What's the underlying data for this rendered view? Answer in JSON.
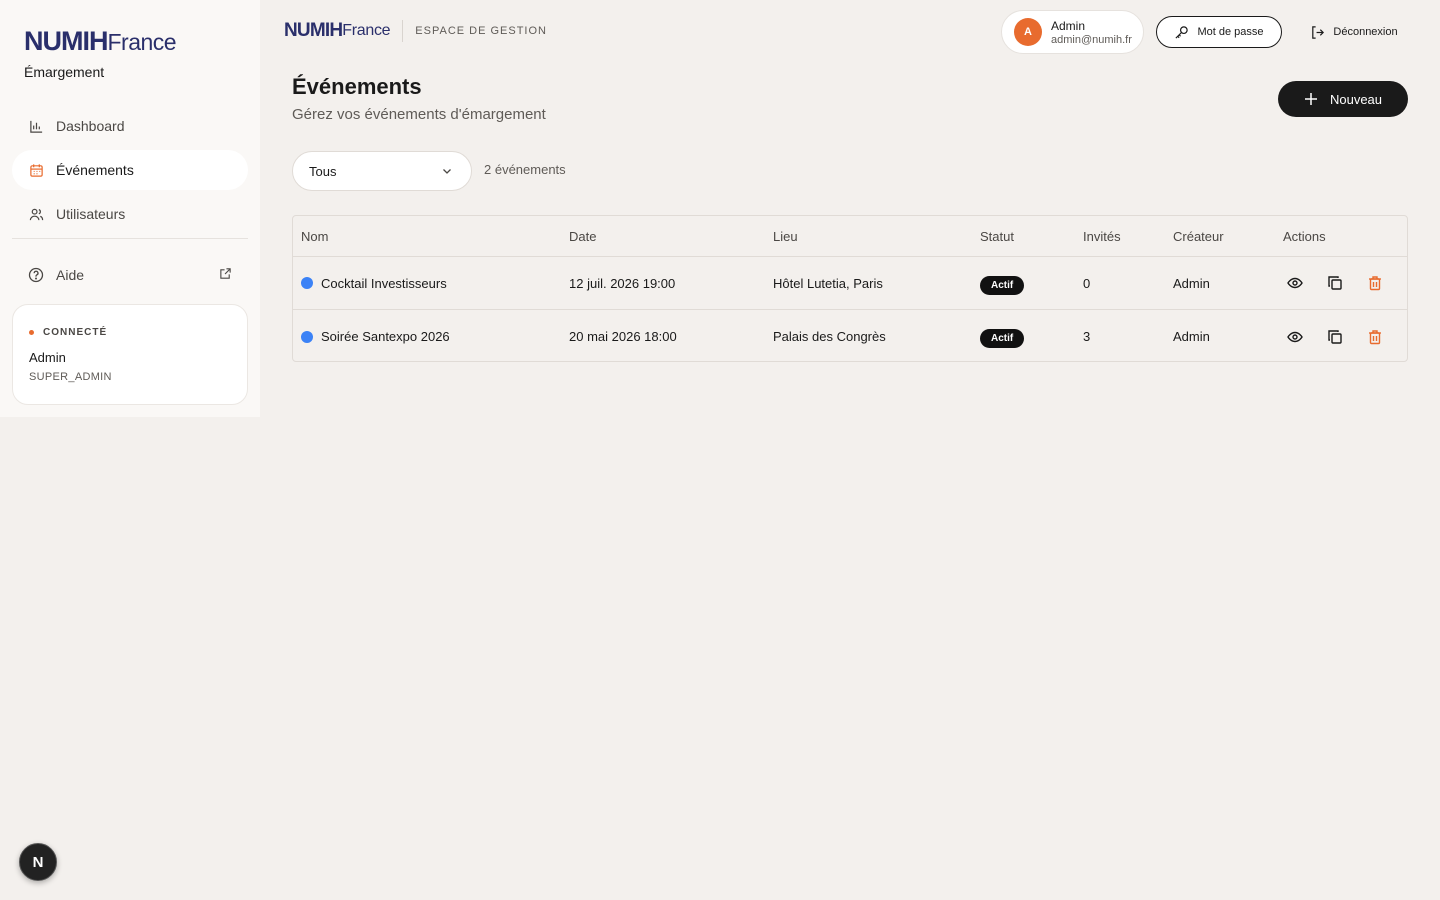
{
  "brand": {
    "numih": "NUMIH",
    "france": "France",
    "app_name": "Émargement"
  },
  "sidebar": {
    "items": [
      {
        "label": "Dashboard",
        "icon": "bar-chart-icon"
      },
      {
        "label": "Événements",
        "icon": "calendar-icon",
        "active": true
      },
      {
        "label": "Utilisateurs",
        "icon": "users-icon"
      }
    ],
    "help": {
      "label": "Aide",
      "icon": "help-circle-icon"
    },
    "connected": {
      "label": "CONNECTÉ",
      "name": "Admin",
      "role": "SUPER_ADMIN"
    }
  },
  "topbar": {
    "space_label": "ESPACE DE GESTION",
    "user": {
      "initial": "A",
      "name": "Admin",
      "email": "admin@numih.fr"
    },
    "password_label": "Mot de passe",
    "logout_label": "Déconnexion"
  },
  "header": {
    "title": "Événements",
    "subtitle": "Gérez vos événements d'émargement",
    "new_label": "Nouveau"
  },
  "filter": {
    "selected": "Tous",
    "count_text": "2 événements"
  },
  "table": {
    "columns": [
      "Nom",
      "Date",
      "Lieu",
      "Statut",
      "Invités",
      "Créateur",
      "Actions"
    ],
    "rows": [
      {
        "name": "Cocktail Investisseurs",
        "date": "12 juil. 2026 19:00",
        "place": "Hôtel Lutetia, Paris",
        "status": "Actif",
        "guests": "0",
        "creator": "Admin"
      },
      {
        "name": "Soirée Santexpo 2026",
        "date": "20 mai 2026 18:00",
        "place": "Palais des Congrès",
        "status": "Actif",
        "guests": "3",
        "creator": "Admin"
      }
    ]
  },
  "colors": {
    "accent": "#e86b2e",
    "brand": "#2a2f6b",
    "dot": "#3b82f6",
    "dark": "#1a1a1a"
  },
  "dev_badge": "N"
}
